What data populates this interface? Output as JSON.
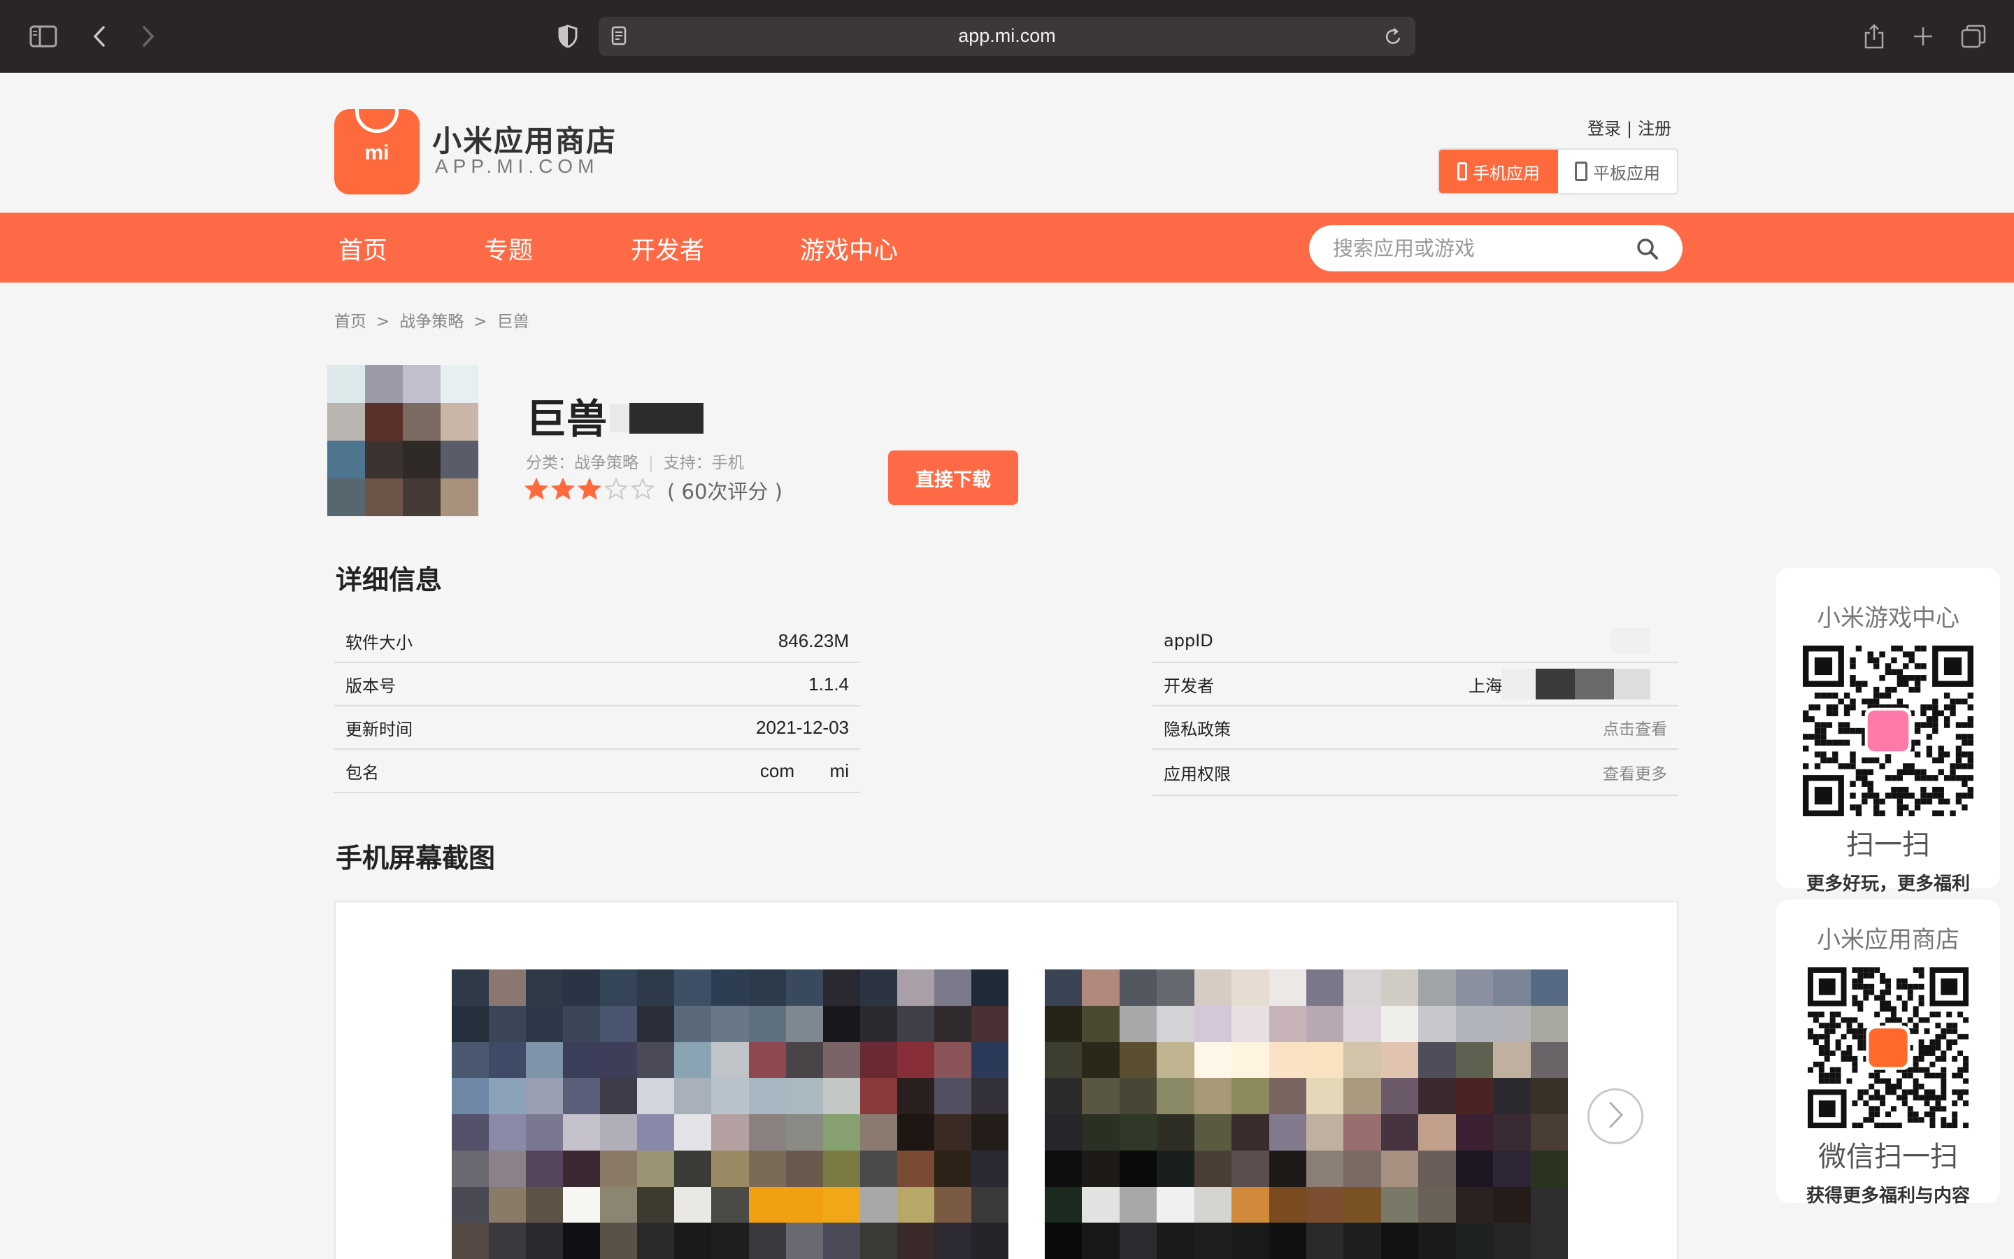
{
  "browser": {
    "url": "app.mi.com"
  },
  "header": {
    "logo_mark": "mi",
    "title": "小米应用商店",
    "subtitle": "APP.MI.COM",
    "login": "登录",
    "divider": "|",
    "register": "注册",
    "device_tabs": [
      {
        "label": "手机应用",
        "active": true
      },
      {
        "label": "平板应用",
        "active": false
      }
    ]
  },
  "nav": {
    "items": [
      "首页",
      "专题",
      "开发者",
      "游戏中心"
    ],
    "search_placeholder": "搜索应用或游戏"
  },
  "breadcrumb": [
    "首页",
    "战争策略",
    "巨兽"
  ],
  "breadcrumb_separator": ">",
  "app": {
    "name": "巨兽",
    "category_label": "分类：",
    "category": "战争策略",
    "support_label": "支持：",
    "support": "手机",
    "rating_stars": 3,
    "rating_max": 5,
    "rating_count_text": "( 60次评分 )",
    "download_button": "直接下载"
  },
  "details": {
    "title": "详细信息",
    "left": [
      {
        "label": "软件大小",
        "value": "846.23M"
      },
      {
        "label": "版本号",
        "value": "1.1.4"
      },
      {
        "label": "更新时间",
        "value": "2021-12-03"
      },
      {
        "label": "包名",
        "value": "com       mi"
      }
    ],
    "right": [
      {
        "label": "appID",
        "value": ""
      },
      {
        "label": "开发者",
        "value": "上海"
      },
      {
        "label": "隐私政策",
        "value": "点击查看"
      },
      {
        "label": "应用权限",
        "value": "查看更多"
      }
    ]
  },
  "screenshots": {
    "title": "手机屏幕截图"
  },
  "qr_cards": [
    {
      "title": "小米游戏中心",
      "big": "扫一扫",
      "small": "更多好玩，更多福利"
    },
    {
      "title": "小米应用商店",
      "big": "微信扫一扫",
      "small": "获得更多福利与内容"
    }
  ],
  "colors": {
    "brand": "#ff6a46",
    "chrome": "#2a2526"
  },
  "icons": [
    "sidebar-icon",
    "back-icon",
    "forward-icon",
    "shield-icon",
    "page-icon",
    "reload-icon",
    "share-icon",
    "plus-icon",
    "tabs-icon",
    "search-icon",
    "star-icon",
    "chevron-right-icon"
  ]
}
